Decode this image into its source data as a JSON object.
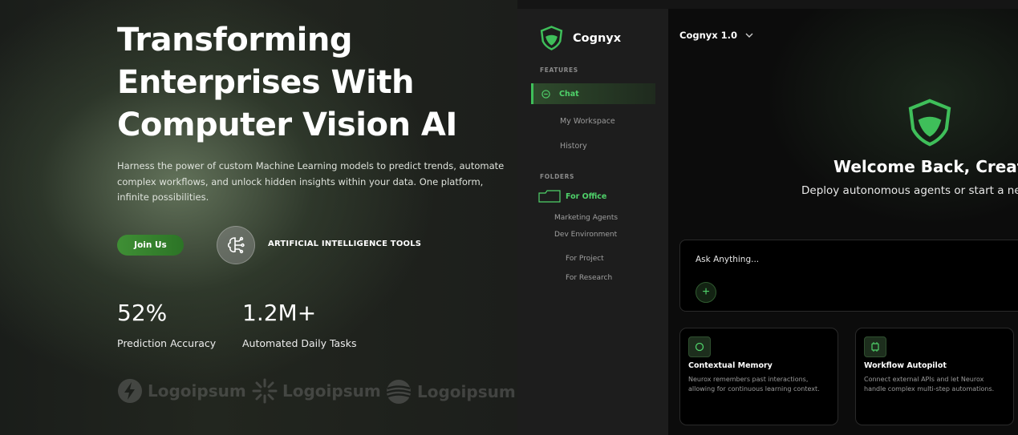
{
  "hero": {
    "title": "Transforming Enterprises With Computer Vision AI",
    "description": "Harness the power of custom Machine Learning models to predict trends, automate complex workflows, and unlock hidden insights within your data. One platform, infinite possibilities.",
    "cta_label": "Join Us",
    "tools_label": "ARTIFICIAL INTELLIGENCE TOOLS",
    "stats": [
      {
        "value": "52%",
        "label": "Prediction Accuracy"
      },
      {
        "value": "1.2M+",
        "label": "Automated Daily Tasks"
      }
    ],
    "logos": [
      "Logoipsum",
      "Logoipsum",
      "Logoipsum"
    ]
  },
  "app": {
    "brand": "Cognyx",
    "version": "Cognyx 1.0",
    "sidebar": {
      "features_label": "FEATURES",
      "items": [
        "Chat",
        "My Workspace",
        "History"
      ],
      "folders_label": "FOLDERS",
      "folder_active": "For Office",
      "folder_children": [
        "Marketing Agents",
        "Dev Environment"
      ],
      "folder_nested": [
        "For Project",
        "For Research"
      ]
    },
    "welcome": {
      "title": "Welcome Back, Creator",
      "subtitle": "Deploy autonomous agents or start a new chat"
    },
    "ask": {
      "placeholder": "Ask Anything..."
    },
    "cards": [
      {
        "title": "Contextual Memory",
        "desc": "Neurox remembers past interactions, allowing for continuous learning context."
      },
      {
        "title": "Workflow Autopilot",
        "desc": "Connect external APIs and let Neurox handle complex multi-step automations."
      }
    ],
    "accent": "#4fd16a"
  }
}
